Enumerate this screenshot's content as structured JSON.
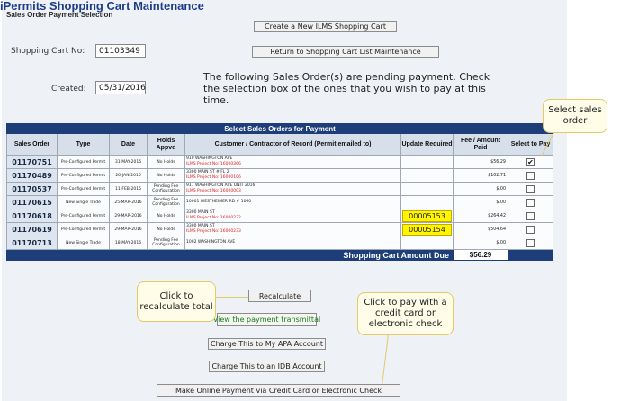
{
  "app_title": "iPermits Shopping Cart Maintenance",
  "sub_title": "Sales Order Payment Selection",
  "buttons": {
    "create": "Create a New ILMS Shopping Cart",
    "return": "Return to Shopping Cart List Maintenance",
    "recalculate": "Recalculate",
    "view_transmittal": "View the payment transmittal",
    "charge_apa": "Charge This to My APA Account",
    "charge_idb": "Charge This to an IDB Account",
    "pay_online": "Make Online Payment via Credit Card or Electronic Check"
  },
  "cart": {
    "cart_no_label": "Shopping Cart No:",
    "cart_no": "01103349",
    "created_label": "Created:",
    "created": "05/31/2016"
  },
  "instructions": "The following Sales Order(s) are pending payment. Check the selection box of the ones that you wish to pay at this time.",
  "table": {
    "caption": "Select Sales Orders for Payment",
    "columns": [
      "Sales Order",
      "Type",
      "Date",
      "Holds Appvd",
      "Customer / Contractor of Record (Permit emailed to)",
      "Update Required",
      "Fee / Amount Paid",
      "Select to Pay"
    ],
    "rows": [
      {
        "so": "01170751",
        "type": "Pre-Configured Permit",
        "date": "31-MAY-2016",
        "holds": "No Holds",
        "addr": "910 WASHINGTON AVE",
        "project": "ILMS Project No: 16000366",
        "update": "",
        "fee": "$56.29",
        "selected": true
      },
      {
        "so": "01170489",
        "type": "Pre-Configured Permit",
        "date": "26-JAN-2016",
        "holds": "No Holds",
        "addr": "3300 MAIN ST # FL 2",
        "project": "ILMS Project No: 16000106",
        "update": "",
        "fee": "$102.71",
        "selected": false
      },
      {
        "so": "01170537",
        "type": "Pre-Configured Permit",
        "date": "11-FEB-2016",
        "holds": "Pending Fee Configuration",
        "addr": "911 WASHINGTON AVE UNIT 2016",
        "project": "ILMS Project No: 16000003",
        "update": "",
        "fee": "$.00",
        "selected": false
      },
      {
        "so": "01170615",
        "type": "New Single Trade",
        "date": "25-MAR-2016",
        "holds": "Pending Fee Configuration",
        "addr": "10001 WESTHEIMER RD # 1060",
        "project": "",
        "update": "",
        "fee": "$.00",
        "selected": false
      },
      {
        "so": "01170618",
        "type": "Pre-Configured Permit",
        "date": "29-MAR-2016",
        "holds": "No Holds",
        "addr": "3300 MAIN ST",
        "project": "ILMS Project No: 16000232",
        "update": "00005153",
        "fee": "$264.42",
        "selected": false
      },
      {
        "so": "01170619",
        "type": "Pre-Configured Permit",
        "date": "29-MAR-2016",
        "holds": "No Holds",
        "addr": "3300 MAIN ST",
        "project": "ILMS Project No: 16000233",
        "update": "00005154",
        "fee": "$504.64",
        "selected": false
      },
      {
        "so": "01170713",
        "type": "New Single Trade",
        "date": "18-MAY-2016",
        "holds": "Pending Fee Configuration",
        "addr": "1002 WASHINGTON AVE",
        "project": "",
        "update": "",
        "fee": "$.00",
        "selected": false
      }
    ],
    "total_label": "Shopping Cart Amount Due",
    "total_value": "$56.29"
  },
  "callouts": {
    "select": "Select sales order",
    "recalc": "Click to recalculate total",
    "pay": "Click to pay with a credit card or electronic check"
  },
  "colors": {
    "title": "#1f3c88",
    "table_header": "#1d3e78",
    "update_highlight": "#fff500",
    "project_text": "#dd2222"
  }
}
